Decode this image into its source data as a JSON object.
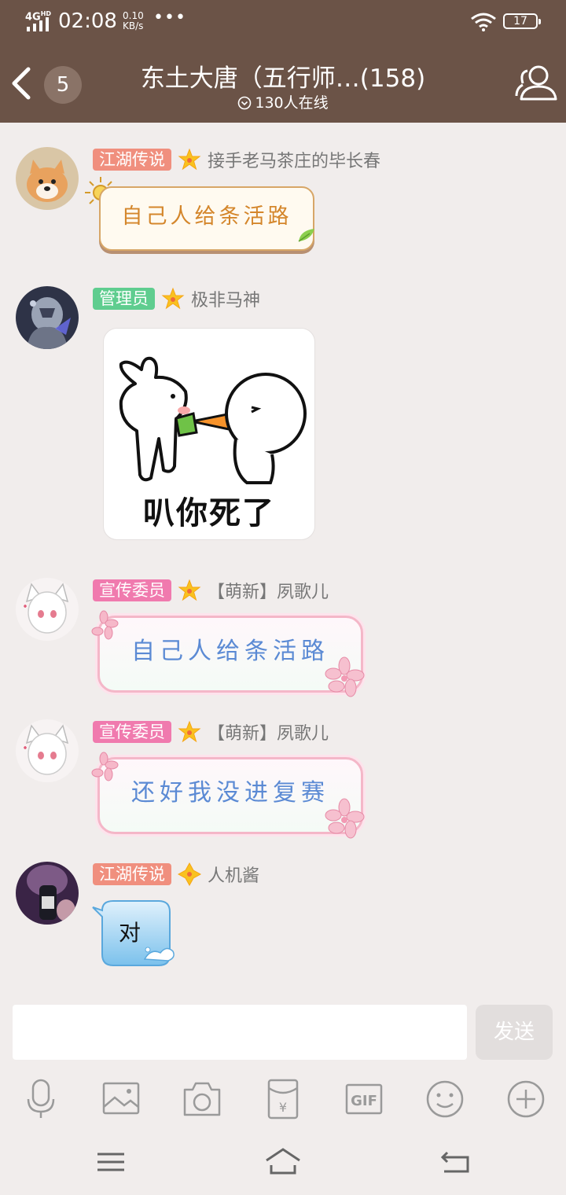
{
  "status_bar": {
    "network": "4G",
    "network_hd": "HD",
    "time": "02:08",
    "speed_value": "0.10",
    "speed_unit": "KB/s",
    "more": "•••",
    "battery": "17"
  },
  "header": {
    "unread_count": "5",
    "title": "东土大唐（五行师…(158)",
    "online": "130人在线"
  },
  "colors": {
    "header_bg": "#6b5347",
    "tag_jianghu": "#f08f7e",
    "tag_admin": "#5fcd8f",
    "tag_xuanchuan": "#f07aae",
    "page_bg": "#f1edec"
  },
  "messages": [
    {
      "tag": "江湖传说",
      "tag_color": "#f08f7e",
      "sender": "接手老马茶庄的毕长春",
      "text": "自己人给条活路",
      "avatar": "shiba-dog-avatar"
    },
    {
      "tag": "管理员",
      "tag_color": "#5fcd8f",
      "sender": "极非马神",
      "sticker_text": "叭你死了",
      "avatar": "armored-warrior-avatar"
    },
    {
      "tag": "宣传委员",
      "tag_color": "#f07aae",
      "sender": "【萌新】夙歌儿",
      "text": "自己人给条活路",
      "avatar": "anime-catgirl-avatar"
    },
    {
      "tag": "宣传委员",
      "tag_color": "#f07aae",
      "sender": "【萌新】夙歌儿",
      "text": "还好我没进复赛",
      "avatar": "anime-catgirl-avatar"
    },
    {
      "tag": "江湖传说",
      "tag_color": "#f08f7e",
      "sender": "人机酱",
      "text": "对",
      "avatar": "bottle-avatar"
    }
  ],
  "input": {
    "value": "",
    "send_label": "发送"
  },
  "toolbar": {
    "gif_label": "GIF",
    "items": [
      "microphone-icon",
      "image-icon",
      "camera-icon",
      "red-packet-icon",
      "gif-icon",
      "emoji-icon",
      "plus-icon"
    ]
  },
  "nav": {
    "items": [
      "menu-icon",
      "home-icon",
      "back-icon"
    ]
  }
}
